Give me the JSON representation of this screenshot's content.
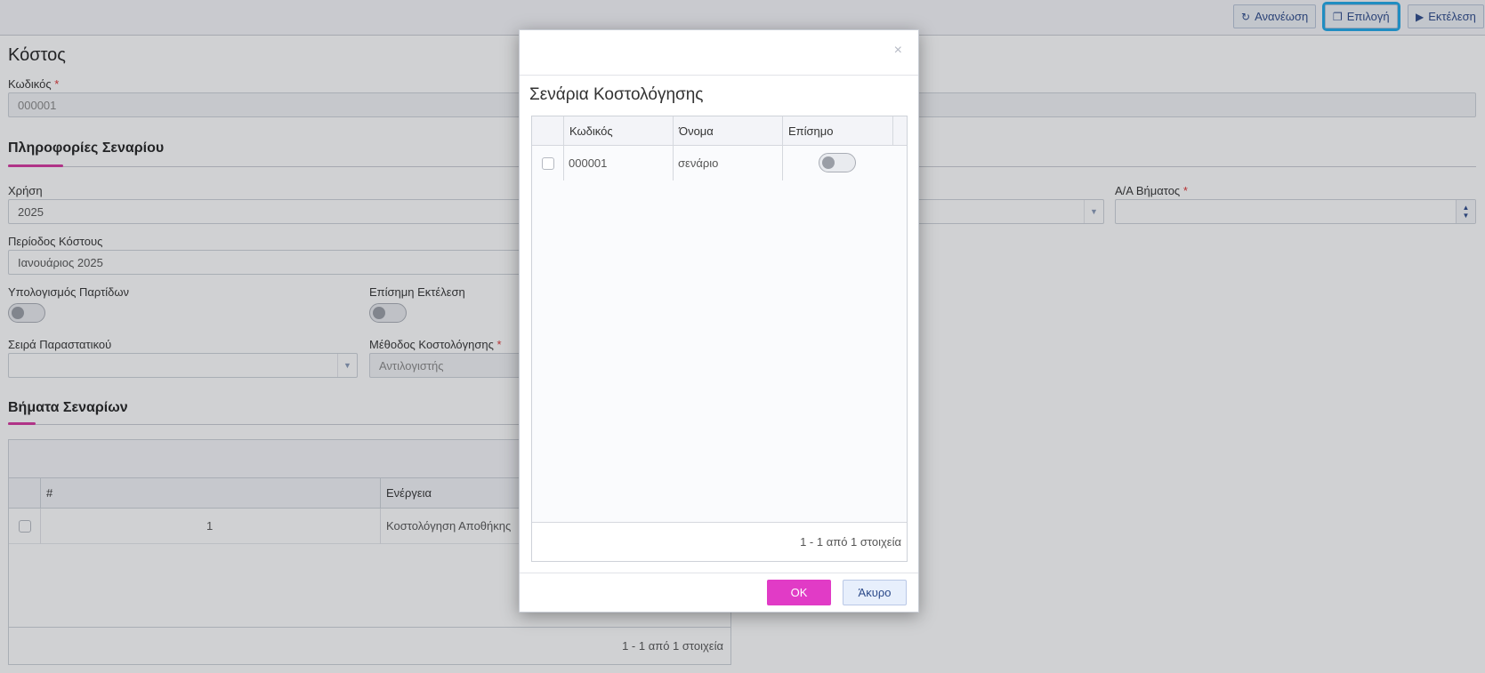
{
  "toolbar": {
    "refresh_label": "Ανανέωση",
    "select_label": "Επιλογή",
    "run_label": "Εκτέλεση",
    "refresh_icon": "refresh-icon",
    "select_icon": "select-icon",
    "run_icon": "play-icon"
  },
  "form": {
    "title": "Κόστος",
    "code_label": "Κωδικός",
    "code_value": "000001",
    "scenario_info_title": "Πληροφορίες Σεναρίου",
    "year_label": "Χρήση",
    "year_value": "2025",
    "step_no_label": "Α/Α Βήματος",
    "period_label": "Περίοδος Κόστους",
    "period_value": "Ιανουάριος 2025",
    "batch_calc_label": "Υπολογισμός Παρτίδων",
    "official_run_label": "Επίσημη Εκτέλεση",
    "doc_series_label": "Σειρά Παραστατικού",
    "method_label": "Μέθοδος Κοστολόγησης",
    "method_value": "Αντιλογιστής",
    "steps_title": "Βήματα Σεναρίων"
  },
  "steps_grid": {
    "columns": [
      "#",
      "Ενέργεια"
    ],
    "rows": [
      {
        "num": "1",
        "action": "Κοστολόγηση Αποθήκης"
      }
    ],
    "footer": "1 - 1 από 1 στοιχεία"
  },
  "modal": {
    "title": "Σενάρια Κοστολόγησης",
    "close_symbol": "×",
    "columns": [
      "Κωδικός",
      "Όνομα",
      "Επίσημο"
    ],
    "rows": [
      {
        "code": "000001",
        "name": "σενάριο",
        "official": false
      }
    ],
    "footer": "1 - 1 από 1 στοιχεία",
    "ok_label": "OK",
    "cancel_label": "Άκυρο"
  },
  "colors": {
    "accent": "#d6359e",
    "ok_button": "#e13bc6",
    "highlight": "#1ea8e8"
  }
}
